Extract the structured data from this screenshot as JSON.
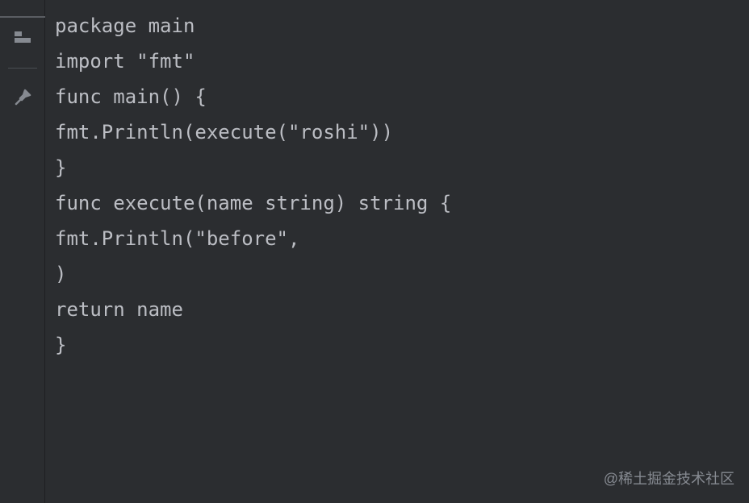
{
  "code": {
    "lines": [
      "package main",
      "",
      "import \"fmt\"",
      "",
      "func main() {",
      "fmt.Println(execute(\"roshi\"))",
      "}",
      "",
      "func execute(name string) string {",
      "fmt.Println(\"before\",",
      ")",
      "",
      "return name",
      "}"
    ]
  },
  "watermark": "@稀土掘金技术社区"
}
